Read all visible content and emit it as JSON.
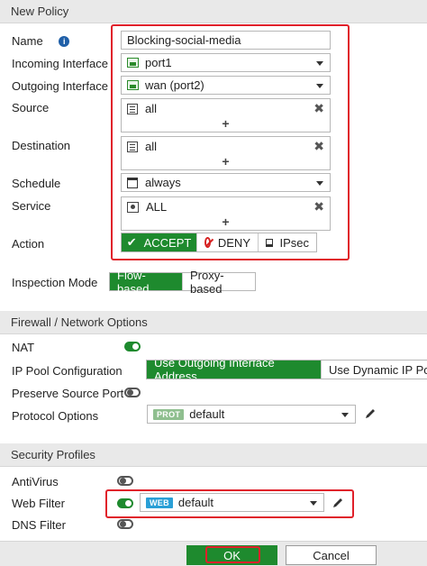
{
  "header": {
    "title": "New Policy"
  },
  "form": {
    "name_label": "Name",
    "name_value": "Blocking-social-media",
    "incoming_label": "Incoming Interface",
    "incoming_value": "port1",
    "outgoing_label": "Outgoing Interface",
    "outgoing_value": "wan (port2)",
    "source_label": "Source",
    "source_value": "all",
    "destination_label": "Destination",
    "destination_value": "all",
    "schedule_label": "Schedule",
    "schedule_value": "always",
    "service_label": "Service",
    "service_value": "ALL",
    "action_label": "Action",
    "action_options": {
      "accept": "ACCEPT",
      "deny": "DENY",
      "ipsec": "IPsec"
    },
    "action_selected": "ACCEPT",
    "inspection_label": "Inspection Mode",
    "inspection_options": {
      "flow": "Flow-based",
      "proxy": "Proxy-based"
    },
    "inspection_selected": "Flow-based"
  },
  "firewall": {
    "title": "Firewall / Network Options",
    "nat_label": "NAT",
    "nat_enabled": true,
    "ip_pool_label": "IP Pool Configuration",
    "ip_pool_options": {
      "outgoing": "Use Outgoing Interface Address",
      "dynamic": "Use Dynamic IP Poo"
    },
    "ip_pool_selected": "Use Outgoing Interface Address",
    "preserve_label": "Preserve Source Port",
    "preserve_enabled": false,
    "protocol_label": "Protocol Options",
    "protocol_badge": "PROT",
    "protocol_value": "default"
  },
  "security": {
    "title": "Security Profiles",
    "antivirus_label": "AntiVirus",
    "antivirus_enabled": false,
    "webfilter_label": "Web Filter",
    "webfilter_enabled": true,
    "webfilter_badge": "WEB",
    "webfilter_value": "default",
    "dnsfilter_label": "DNS Filter",
    "dnsfilter_enabled": false
  },
  "footer": {
    "ok_label": "OK",
    "cancel_label": "Cancel"
  },
  "colors": {
    "accent_green": "#1e8a2e",
    "highlight_red": "#e0202a",
    "info_blue": "#1f5fa8",
    "prot_badge": "#8fbf8f",
    "web_badge": "#2a9fd6"
  },
  "icons": {
    "name_info": "info-icon",
    "interface": "interface-icon",
    "address": "address-icon",
    "remove": "close-icon",
    "add": "plus-icon",
    "schedule": "calendar-icon",
    "service": "service-icon",
    "accept": "checkmark-icon",
    "deny": "deny-icon",
    "ipsec": "monitor-icon",
    "edit": "pencil-icon",
    "dropdown": "chevron-down-icon"
  }
}
